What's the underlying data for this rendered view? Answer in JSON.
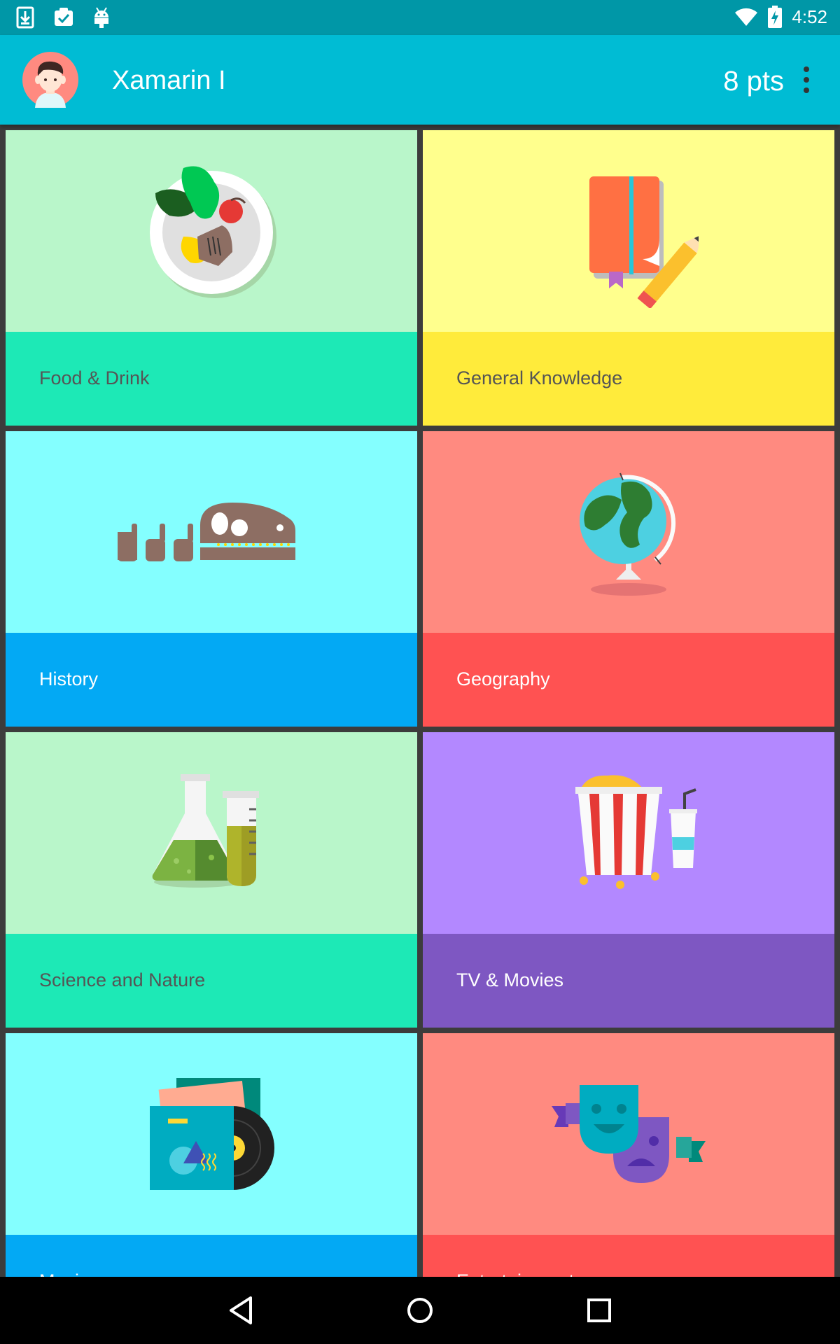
{
  "status_bar": {
    "time": "4:52",
    "left_icons": [
      "download-icon",
      "clipboard-check-icon",
      "android-icon"
    ],
    "right_icons": [
      "wifi-icon",
      "battery-charging-icon"
    ]
  },
  "app_bar": {
    "user_name": "Xamarin I",
    "points": "8 pts",
    "background": "#00bcd4"
  },
  "categories": [
    {
      "label": "Food & Drink",
      "icon": "food-plate-icon",
      "art_color": "#b9f6ca",
      "bar_color": "#1de9b6",
      "text_color": "#555555"
    },
    {
      "label": "General Knowledge",
      "icon": "book-pencil-icon",
      "art_color": "#ffff8d",
      "bar_color": "#ffeb3b",
      "text_color": "#555555"
    },
    {
      "label": "History",
      "icon": "dinosaur-fossil-icon",
      "art_color": "#84ffff",
      "bar_color": "#03a9f4",
      "text_color": "#ffffff"
    },
    {
      "label": "Geography",
      "icon": "globe-icon",
      "art_color": "#ff8a80",
      "bar_color": "#ff5252",
      "text_color": "#ffffff"
    },
    {
      "label": "Science and Nature",
      "icon": "lab-flask-icon",
      "art_color": "#b9f6ca",
      "bar_color": "#1de9b6",
      "text_color": "#555555"
    },
    {
      "label": "TV & Movies",
      "icon": "popcorn-icon",
      "art_color": "#b388ff",
      "bar_color": "#7e57c2",
      "text_color": "#ffffff"
    },
    {
      "label": "Music",
      "icon": "vinyl-record-icon",
      "art_color": "#84ffff",
      "bar_color": "#03a9f4",
      "text_color": "#ffffff"
    },
    {
      "label": "Entertainment",
      "icon": "theater-masks-icon",
      "art_color": "#ff8a80",
      "bar_color": "#ff5252",
      "text_color": "#ffffff"
    }
  ],
  "nav_bar": {
    "icons": [
      "back-icon",
      "home-icon",
      "recents-icon"
    ]
  }
}
